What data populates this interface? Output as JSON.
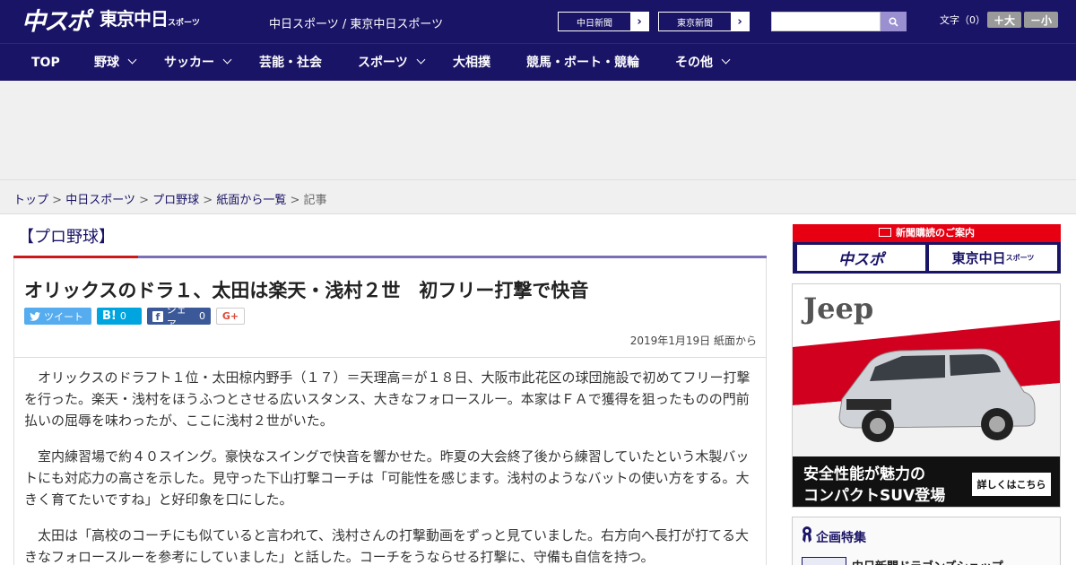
{
  "header": {
    "logo_main": "中スポ",
    "logo_sub": "東京中日",
    "logo_sub_small": "スポーツ",
    "site_links": "中日スポーツ / 東京中日スポーツ",
    "ext_links": [
      {
        "label": "中日新聞",
        "arrow": "›"
      },
      {
        "label": "東京新聞",
        "arrow": "›"
      }
    ],
    "search": {
      "placeholder": "",
      "value": ""
    },
    "text_size": {
      "label": "文字（0）",
      "increase": "＋大",
      "decrease": "－小"
    }
  },
  "nav": {
    "items": [
      {
        "label": "TOP",
        "has_menu": false
      },
      {
        "label": "野球",
        "has_menu": true
      },
      {
        "label": "サッカー",
        "has_menu": true
      },
      {
        "label": "芸能・社会",
        "has_menu": false
      },
      {
        "label": "スポーツ",
        "has_menu": true
      },
      {
        "label": "大相撲",
        "has_menu": false
      },
      {
        "label": "競馬・ボート・競輪",
        "has_menu": false
      },
      {
        "label": "その他",
        "has_menu": true
      }
    ]
  },
  "breadcrumb": {
    "items": [
      "トップ",
      "中日スポーツ",
      "プロ野球",
      "紙面から一覧"
    ],
    "separator": ">",
    "current": "記事"
  },
  "section": {
    "title": "【プロ野球】"
  },
  "article": {
    "headline": "オリックスのドラ１、太田は楽天・浅村２世　初フリー打撃で快音",
    "share": {
      "twitter": "ツイート",
      "hatena_count": "0",
      "hatena_label": "B!",
      "facebook_label": "シェア",
      "facebook_count": "0",
      "gplus": "G+"
    },
    "date": "2019年1月19日 紙面から",
    "paragraphs": [
      "オリックスのドラフト１位・太田椋内野手（１７）＝天理高＝が１８日、大阪市此花区の球団施設で初めてフリー打撃を行った。楽天・浅村をほうふつとさせる広いスタンス、大きなフォロースルー。本家はＦＡで獲得を狙ったものの門前払いの屈辱を味わったが、ここに浅村２世がいた。",
      "室内練習場で約４０スイング。豪快なスイングで快音を響かせた。昨夏の大会終了後から練習していたという木製バットにも対応力の高さを示した。見守った下山打撃コーチは「可能性を感じます。浅村のようなバットの使い方をする。大きく育てたいですね」と好印象を口にした。",
      "太田は「高校のコーチにも似ていると言われて、浅村さんの打撃動画をずっと見ていました。右方向へ長打が打てる大きなフォロースルーを参考にしていました」と話した。コーチをうならせる打撃に、守備も自信を持つ。"
    ]
  },
  "sidebar": {
    "subscription": {
      "title": "新聞購読のご案内",
      "left": "中スポ",
      "right": "東京中日",
      "right_small": "スポーツ"
    },
    "ad": {
      "brand": "Jeep",
      "line1": "安全性能が魅力の",
      "line2": "コンパクトSUV登場",
      "cta": "詳しくはこちら"
    },
    "feature": {
      "title": "企画特集",
      "item": "中日新聞ドラゴンズショップ"
    }
  },
  "colors": {
    "brand": "#1a1466",
    "accent_red": "#cc1a1a",
    "rule_purple": "#7a6fb6"
  }
}
